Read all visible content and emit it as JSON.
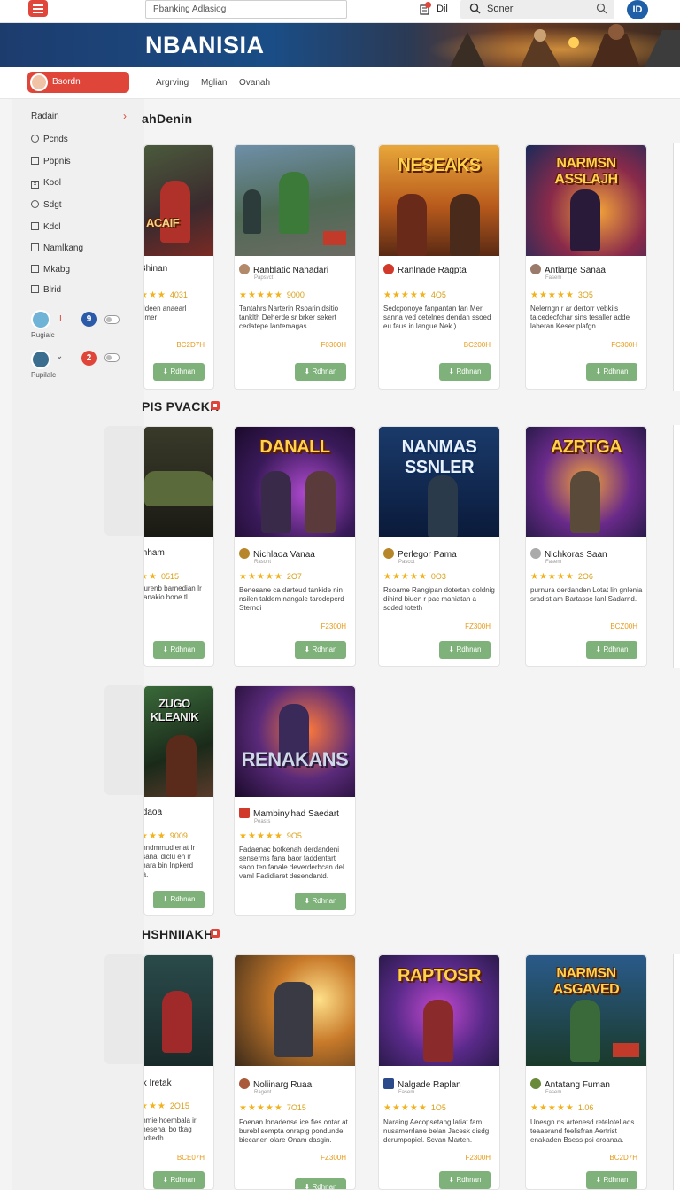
{
  "topbar": {
    "search_placeholder": "Pbanking Adlasiog",
    "user_label": "Dil",
    "search2_value": "Soner",
    "brand_initials": "ID"
  },
  "banner": {
    "title": "NBANISIA"
  },
  "nav": {
    "active_label": "Bsordn",
    "links": [
      "Argrving",
      "Mglian",
      "Ovanah"
    ]
  },
  "sidebar": {
    "title": "Radain",
    "items": [
      {
        "label": "Pcnds",
        "kind": "radio"
      },
      {
        "label": "Pbpnis",
        "kind": "check"
      },
      {
        "label": "Kool",
        "kind": "check-x"
      },
      {
        "label": "Sdgt",
        "kind": "radio"
      },
      {
        "label": "Kdcl",
        "kind": "check"
      },
      {
        "label": "Namlkang",
        "kind": "check"
      },
      {
        "label": "Mkabg",
        "kind": "check"
      },
      {
        "label": "Blrid",
        "kind": "check"
      }
    ],
    "users": [
      {
        "label": "Rugialc",
        "mark": "I",
        "badge": "9",
        "badge_color": "#2a5aa8"
      },
      {
        "label": "Pupilalc",
        "mark": "⌄",
        "badge": "2",
        "badge_color": "#e0453a"
      }
    ]
  },
  "sections": [
    {
      "title": "ahDenin"
    },
    {
      "title": "PIS PVACKH"
    },
    {
      "title": ""
    },
    {
      "title": "HSHNIIAKH"
    }
  ],
  "cards": {
    "row1": [
      {
        "art_title": "ACAIF",
        "author": "Bhinan",
        "rating": "4031",
        "desc": "Ndeen anaearl Emer",
        "price": "BC2D7H",
        "button": "Rdhnan"
      },
      {
        "art_title": "",
        "author": "Ranblatic Nahadari",
        "sub": "Papsvct",
        "rating": "9000",
        "desc": "Tantahrs Narterin Rsoarin dsitio tanklth Deherde sr brker sekert cedatepe lantemagas.",
        "price": "F0300H",
        "button": "Rdhnan"
      },
      {
        "art_title": "NESEAKS",
        "author": "Ranlnade Ragpta",
        "rating": "4O5",
        "desc": "Sedcponoye fanpantan fan Mer sanna ved cetelnes dendan ssoed eu faus in langue Nek.)",
        "price": "BC200H",
        "button": "Rdhnan"
      },
      {
        "art_title": "NARMSN ASSLAJH",
        "author": "Antlarge Sanaa",
        "sub": "Fasem",
        "rating": "3O5",
        "desc": "Nelerngn r ar dertorr vebkils talcedecfchar sins tesaller adde laberan Keser plafgn.",
        "price": "FC300H",
        "button": "Rdhnan"
      }
    ],
    "row2": [
      {
        "art_title": "",
        "author": "Inham",
        "rating": "0515",
        "desc": "burenb barnedian Ir fianakio hone tl",
        "price": "",
        "button": "Rdhnan"
      },
      {
        "art_title": "DANALL",
        "author": "Nichlaoa Vanaa",
        "sub": "Rasont",
        "rating": "2O7",
        "desc": "Benesane ca darteud tankide nin nsilen taldem nangale tarodeperd Sterndi",
        "price": "F2300H",
        "button": "Rdhnan"
      },
      {
        "art_title": "NANMAS SSNLER",
        "author": "Perlegor Pama",
        "sub": "Pascot",
        "rating": "0O3",
        "desc": "Rsoame Rangipan dotertan doldnig dihind biuen r pac maniatan a sdded toteth",
        "price": "FZ300H",
        "button": "Rdhnan"
      },
      {
        "art_title": "AZRTGA",
        "author": "Nlchkoras Saan",
        "sub": "Fasem",
        "rating": "2O6",
        "desc": "purnura derdanden Lotat lin gnlenia sradist am Bartasse lanl Sadarnd.",
        "price": "BCZ00H",
        "button": "Rdhnan"
      }
    ],
    "row3": [
      {
        "art_title": "ZUGO KLEANIK",
        "author": "Idaoa",
        "rating": "9009",
        "desc": "Inndmmudienat Ir tsanal diclu en ir mara bin Inpkerd ra.",
        "price": "",
        "button": "Rdhnan"
      },
      {
        "art_title": "RENAKANS",
        "author": "Mambiny'had Saedart",
        "sub": "Peasts",
        "rating": "9O5",
        "desc": "Fadaenac botkenah derdandeni senserms fana baor faddentart saon ten fanale deverderbcan del vaml Fadidiaret desendantd.",
        "price": "",
        "button": "Rdhnan"
      }
    ],
    "row4": [
      {
        "art_title": "",
        "author": "Ik Iretak",
        "rating": "2O15",
        "desc": "Ihmie hoembala ir mesenal bo tkag Indtedh.",
        "price": "BCE07H",
        "button": "Rdhnan"
      },
      {
        "art_title": "",
        "author": "Noliinarg Ruaa",
        "sub": "Ragent",
        "rating": "7O15",
        "desc": "Foenan lonadense ice fies ontar at burebl sempta onrapig pondunde biecanen olare Onam dasgin.",
        "price": "FZ300H",
        "button": "Rdhnan"
      },
      {
        "art_title": "RAPTOSR",
        "author": "Nalgade Raplan",
        "sub": "Fasem",
        "rating": "1O5",
        "desc": "Naraing Aecopsetang latiat fam nusamerrlane belan Jacesk disdg derumpopiel. Scvan Marten.",
        "price": "F2300H",
        "button": "Rdhnan"
      },
      {
        "art_title": "NARMSN ASGAVED",
        "author": "Antatang Fuman",
        "sub": "Fasem",
        "rating": "1.06",
        "desc": "Unesgn ns artenesd retelotel ads teaaerand feelisfran Aertrist enakaden Bsess psi eroanaa.",
        "price": "BC2D7H",
        "button": "Rdhnan"
      }
    ]
  },
  "colors": {
    "accent": "#e0453a",
    "button": "#7fb27a",
    "star": "#f2b21b",
    "price": "#e79a1a"
  }
}
